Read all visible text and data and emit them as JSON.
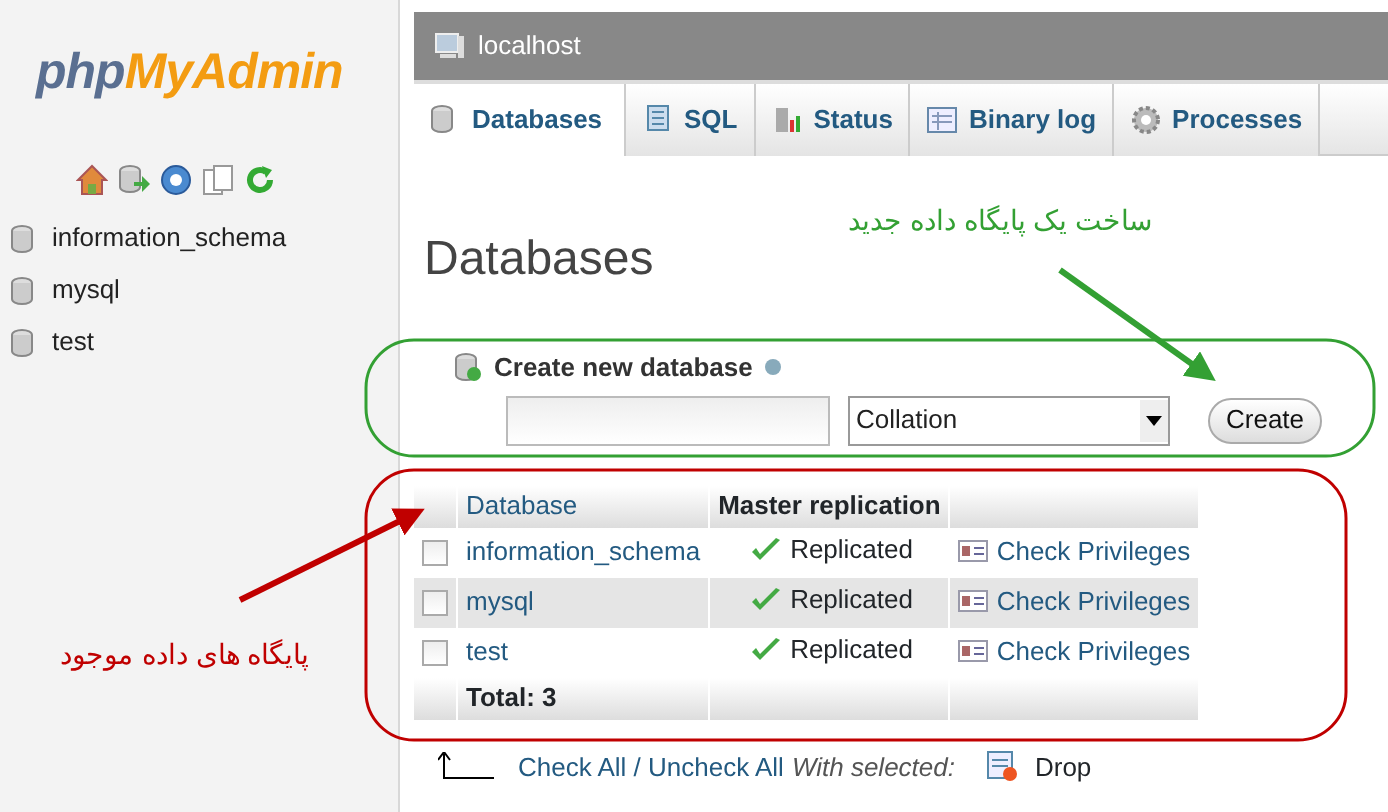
{
  "logo": {
    "part_1": "php",
    "part_2": "MyAdmin"
  },
  "sidebar": {
    "databases": [
      {
        "name": "information_schema"
      },
      {
        "name": "mysql"
      },
      {
        "name": "test"
      }
    ]
  },
  "server": {
    "title": "localhost"
  },
  "tabs": [
    {
      "label": "Databases",
      "selected": true
    },
    {
      "label": "SQL",
      "selected": false
    },
    {
      "label": "Status",
      "selected": false
    },
    {
      "label": "Binary log",
      "selected": false
    },
    {
      "label": "Processes",
      "selected": false
    }
  ],
  "heading": "Databases",
  "create_form": {
    "label": "Create new database",
    "collation": "Collation",
    "button": "Create"
  },
  "table": {
    "columns": [
      "Database",
      "Master replication"
    ],
    "rows": [
      {
        "name": "information_schema",
        "checked": false,
        "replication": "Replicated",
        "action": "Check Privileges"
      },
      {
        "name": "mysql",
        "checked": false,
        "replication": "Replicated",
        "action": "Check Privileges"
      },
      {
        "name": "test",
        "checked": false,
        "replication": "Replicated",
        "action": "Check Privileges"
      }
    ],
    "total": "Total: 3"
  },
  "footer": {
    "check_all": "Check All / Uncheck All",
    "with_selected": "With selected:",
    "drop": "Drop"
  },
  "annotations": [
    {
      "text": "ساخت یک پایگاه داده جدید",
      "color": "#33a033"
    },
    {
      "text": "پایگاه های داده موجود",
      "color": "#c00000"
    }
  ]
}
